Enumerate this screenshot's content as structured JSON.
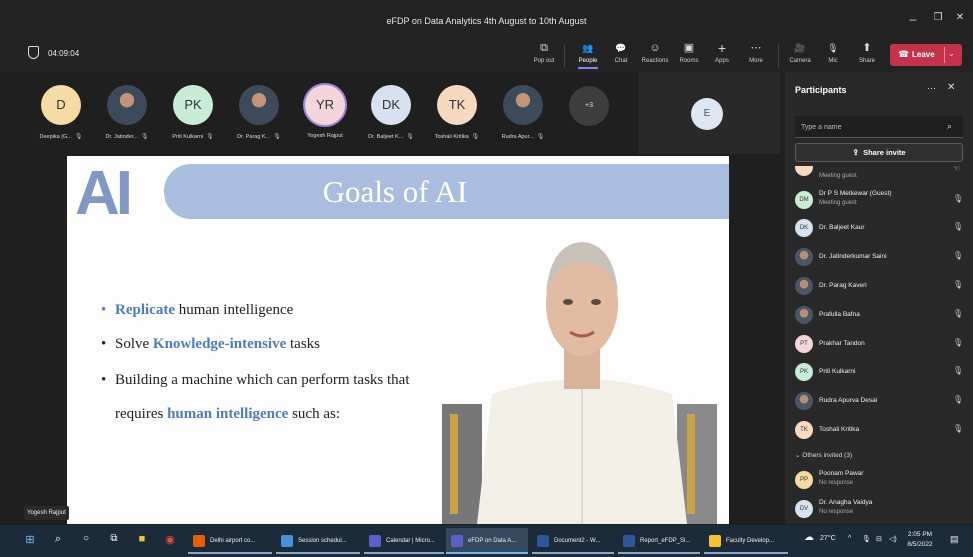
{
  "window": {
    "title": "eFDP on Data Analytics 4th August to 10th August",
    "minimize": "–",
    "maximize": "❐",
    "close": "✕"
  },
  "meeting": {
    "timer": "04:09:04",
    "toolbar": [
      {
        "label": "Pop out",
        "icon": "pop-out-icon",
        "glyph": "⧉"
      },
      {
        "label": "People",
        "icon": "people-icon",
        "glyph": "👥"
      },
      {
        "label": "Chat",
        "icon": "chat-icon",
        "glyph": "💬"
      },
      {
        "label": "Reactions",
        "icon": "reactions-icon",
        "glyph": "☺"
      },
      {
        "label": "Rooms",
        "icon": "rooms-icon",
        "glyph": "▣"
      },
      {
        "label": "Apps",
        "icon": "apps-icon",
        "glyph": "+"
      },
      {
        "label": "More",
        "icon": "more-icon",
        "glyph": "⋯"
      },
      {
        "label": "Camera",
        "icon": "camera-off-icon",
        "glyph": "🎥"
      },
      {
        "label": "Mic",
        "icon": "mic-off-icon",
        "glyph": "🎙"
      },
      {
        "label": "Share",
        "icon": "share-icon",
        "glyph": "⬆"
      }
    ],
    "leave_label": "Leave",
    "leave_color": "#c4314b"
  },
  "gallery": {
    "participants": [
      {
        "initials": "D",
        "name": "Deepika (G...",
        "color": "#f3dba3",
        "photo": false
      },
      {
        "initials": "",
        "name": "Dr. Jatinder...",
        "color": "",
        "photo": true
      },
      {
        "initials": "PK",
        "name": "Priti Kulkarni",
        "color": "#c8ecd5",
        "photo": false
      },
      {
        "initials": "",
        "name": "Dr. Parag K...",
        "color": "",
        "photo": true
      },
      {
        "initials": "YR",
        "name": "Yogesh Rajput",
        "color": "#f3d6dc",
        "photo": false,
        "speaking": true
      },
      {
        "initials": "DK",
        "name": "Dr. Baljeet K...",
        "color": "#d8e1ef",
        "photo": false
      },
      {
        "initials": "TK",
        "name": "Toshali Kritika",
        "color": "#f6d9bf",
        "photo": false
      },
      {
        "initials": "",
        "name": "Rudra Apur...",
        "color": "",
        "photo": true
      }
    ],
    "overflow_count": "+3",
    "extra_tile_initial": "E"
  },
  "slide": {
    "logo_text": "AI",
    "title": "Goals of AI",
    "bullets": [
      {
        "pre": "",
        "hl": "Replicate",
        "post": " human intelligence",
        "blue_dot": true
      },
      {
        "pre": "Solve ",
        "hl": "Knowledge-intensive",
        "post": " tasks",
        "blue_dot": false
      },
      {
        "pre": "Building a machine which can perform tasks that",
        "hl": "",
        "post": "",
        "blue_dot": false
      },
      {
        "pre": "requires ",
        "hl": "human intelligence",
        "post": " such as:",
        "blue_dot": false
      }
    ]
  },
  "presenter_label": "Yogesh Rajput",
  "panel": {
    "title": "Participants",
    "search_placeholder": "Type a name",
    "invite_label": "Share invite",
    "rows": [
      {
        "initials": "",
        "name": "",
        "sub": "Meeting guest",
        "color": "#f6d9bf",
        "photo": false,
        "partial": true
      },
      {
        "initials": "DM",
        "name": "Dr P S Metkewar (Guest)",
        "sub": "Meeting guest",
        "color": "#c8ecd5",
        "photo": false
      },
      {
        "initials": "DK",
        "name": "Dr. Baljeet Kaur",
        "sub": "",
        "color": "#d8e1ef",
        "photo": false
      },
      {
        "initials": "",
        "name": "Dr. Jatinderkumar Saini",
        "sub": "",
        "color": "",
        "photo": true
      },
      {
        "initials": "",
        "name": "Dr. Parag Kaveri",
        "sub": "",
        "color": "",
        "photo": true
      },
      {
        "initials": "",
        "name": "Prafulla Bafna",
        "sub": "",
        "color": "",
        "photo": true
      },
      {
        "initials": "PT",
        "name": "Prakhar Tandon",
        "sub": "",
        "color": "#f3d6dc",
        "photo": false
      },
      {
        "initials": "PK",
        "name": "Priti Kulkarni",
        "sub": "",
        "color": "#c8ecd5",
        "photo": false
      },
      {
        "initials": "",
        "name": "Rudra Apurva Desai",
        "sub": "",
        "color": "",
        "photo": true
      },
      {
        "initials": "TK",
        "name": "Toshali Kritika",
        "sub": "",
        "color": "#f6d9bf",
        "photo": false
      }
    ],
    "others_invited": "Others invited (3)",
    "invited": [
      {
        "initials": "PP",
        "name": "Poonam Pawar",
        "sub": "No response",
        "color": "#f3dba3"
      },
      {
        "initials": "DV",
        "name": "Dr. Anagha Vaidya",
        "sub": "No response",
        "color": "#d8e1ef"
      }
    ]
  },
  "taskbar": {
    "apps": [
      {
        "label": "Delhi airport co...",
        "color": "#e66000",
        "state": "run"
      },
      {
        "label": "Session schedul...",
        "color": "#4a90d9",
        "state": "run"
      },
      {
        "label": "Calendar | Micro...",
        "color": "#5b5fc7",
        "state": "run"
      },
      {
        "label": "eFDP on Data A...",
        "color": "#5b5fc7",
        "state": "act"
      },
      {
        "label": "Document2 - W...",
        "color": "#2b579a",
        "state": "run"
      },
      {
        "label": "Report_eFDP_Sl...",
        "color": "#2b579a",
        "state": "run"
      },
      {
        "label": "Faculty Develop...",
        "color": "#f4c430",
        "state": "run"
      }
    ],
    "weather": "27°C",
    "time": "2:05 PM",
    "date": "8/5/2022"
  }
}
